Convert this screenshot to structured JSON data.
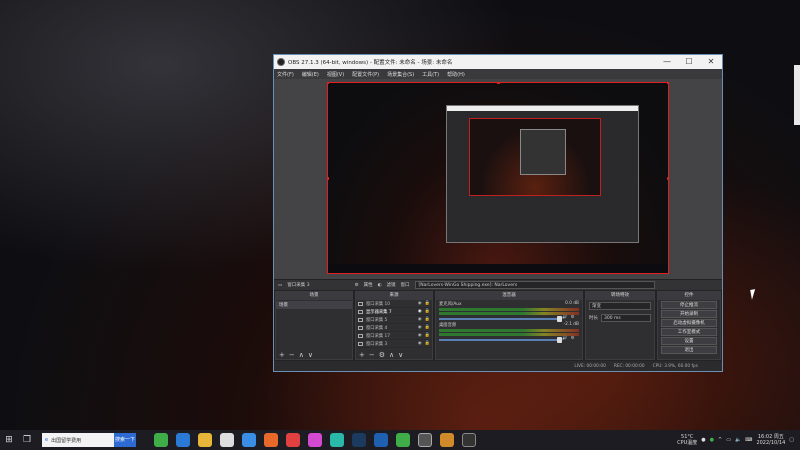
{
  "window": {
    "title": "OBS 27.1.3 (64-bit, windows) - 配置文件: 未命名 - 场景: 未命名",
    "min": "—",
    "max": "☐",
    "close": "✕"
  },
  "menu": [
    "文件(F)",
    "编辑(E)",
    "视图(V)",
    "配置文件(P)",
    "场景集合(S)",
    "工具(T)",
    "帮助(H)"
  ],
  "source_toolbar": {
    "source": "窗口采集 3",
    "props": "属性",
    "filters": "滤镜",
    "window_label": "窗口",
    "window_value": "[NarLovers-WinGo Shipping.exe]: NarLovers"
  },
  "docks": {
    "scenes": {
      "title": "场景",
      "items": [
        "场景"
      ]
    },
    "sources": {
      "title": "来源",
      "items": [
        "窗口采集 10",
        "显示器采集 7",
        "窗口采集 5",
        "窗口采集 4",
        "窗口采集 17",
        "窗口采集 3"
      ]
    },
    "mixer": {
      "title": "混音器",
      "channels": [
        {
          "name": "麦克风/Aux",
          "db": "0.0 dB"
        },
        {
          "name": "桌面音频",
          "db": "-2.1 dB"
        }
      ]
    },
    "transitions": {
      "title": "转场特效",
      "type": "渐变",
      "duration_label": "时长",
      "duration": "300 ms"
    },
    "controls": {
      "title": "控件",
      "buttons": [
        "停止推流",
        "开始录制",
        "启动虚拟摄像机",
        "工作室模式",
        "设置",
        "退出"
      ]
    }
  },
  "statusbar": {
    "live": "LIVE: 00:00:00",
    "rec": "REC: 00:00:00",
    "cpu": "CPU: 3.9%, 60.00 fps"
  },
  "taskbar": {
    "search_placeholder": "出国留学费用",
    "search_button": "搜索一下",
    "temp": "51°C",
    "temp_label": "CPU温度",
    "time": "16:02 周五",
    "date": "2022/10/14"
  }
}
